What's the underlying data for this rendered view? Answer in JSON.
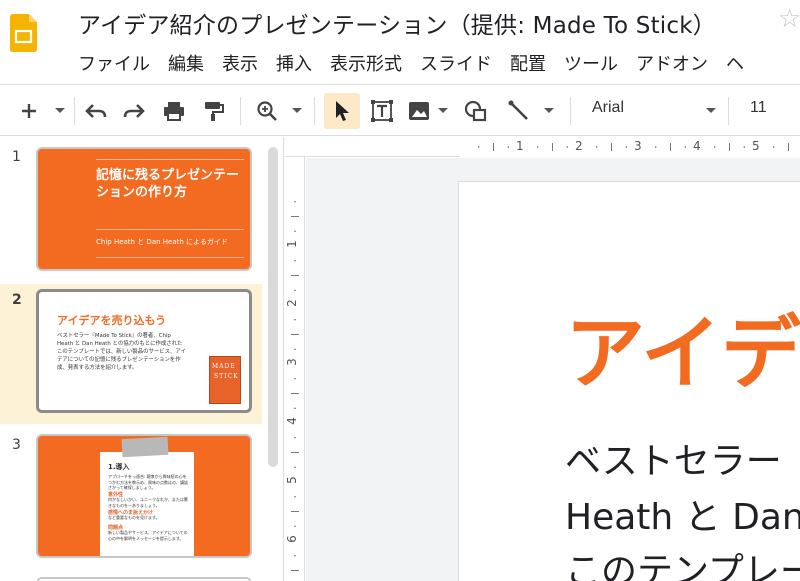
{
  "app": {
    "doc_title": "アイデア紹介のプレゼンテーション（提供: Made To Stick）",
    "menu": [
      "ファイル",
      "編集",
      "表示",
      "挿入",
      "表示形式",
      "スライド",
      "配置",
      "ツール",
      "アドオン",
      "ヘ"
    ]
  },
  "toolbar": {
    "font_name": "Arial",
    "font_size": "11",
    "icons": [
      "plus-icon",
      "undo-icon",
      "redo-icon",
      "print-icon",
      "paint-format-icon",
      "zoom-icon",
      "cursor-icon",
      "text-box-icon",
      "image-icon",
      "shape-icon",
      "line-icon"
    ]
  },
  "filmstrip": {
    "slides": [
      {
        "number": "1",
        "title": "記憶に残るプレゼンテーションの作り方",
        "subtitle": "Chip Heath と Dan Heath によるガイド"
      },
      {
        "number": "2",
        "title": "アイデアを売り込もう",
        "body": "ベストセラー『Made To Stick』の著者、Chip Heath と Dan Heath との協力のもとに作成されたこのテンプレートでは、新しい製品のサービス、アイデアについての記憶に残るプレゼンテーションを作成、発表する方法を紹介します。",
        "book_line1": "MADE",
        "book_line2": "STICK"
      },
      {
        "number": "3",
        "heading": "1.導入",
        "intro": "アプローチをっ適合: 聴衆から興味続の心をつかむ方法を教示め、興味の点数はの、講談さかって確保しましょう。",
        "item1_title": "意外性",
        "item1_text": "何かなしいかい、ユニークなれか、または驚きなものを一ありましょう。",
        "item2_title": "感情へのま訴えかけ",
        "item2_text": "など重要なものを見けます。",
        "item3_title": "問題点",
        "item3_text": "新しい製品やサービス、アイデアについての心の中を解明をメッセージを提示します。"
      }
    ]
  },
  "rulers": {
    "horizontal": [
      "1",
      "2",
      "3",
      "4",
      "5"
    ],
    "vertical": [
      "1",
      "2",
      "3",
      "4",
      "5",
      "6"
    ]
  },
  "slide": {
    "title": "アイデア",
    "line1": "ベストセラー",
    "line2": "Heath と Dan H",
    "line3": "このテンプレー"
  },
  "colors": {
    "accent": "#f26b21",
    "selection": "#fdf1d6",
    "active_tool": "#fde9c7"
  }
}
